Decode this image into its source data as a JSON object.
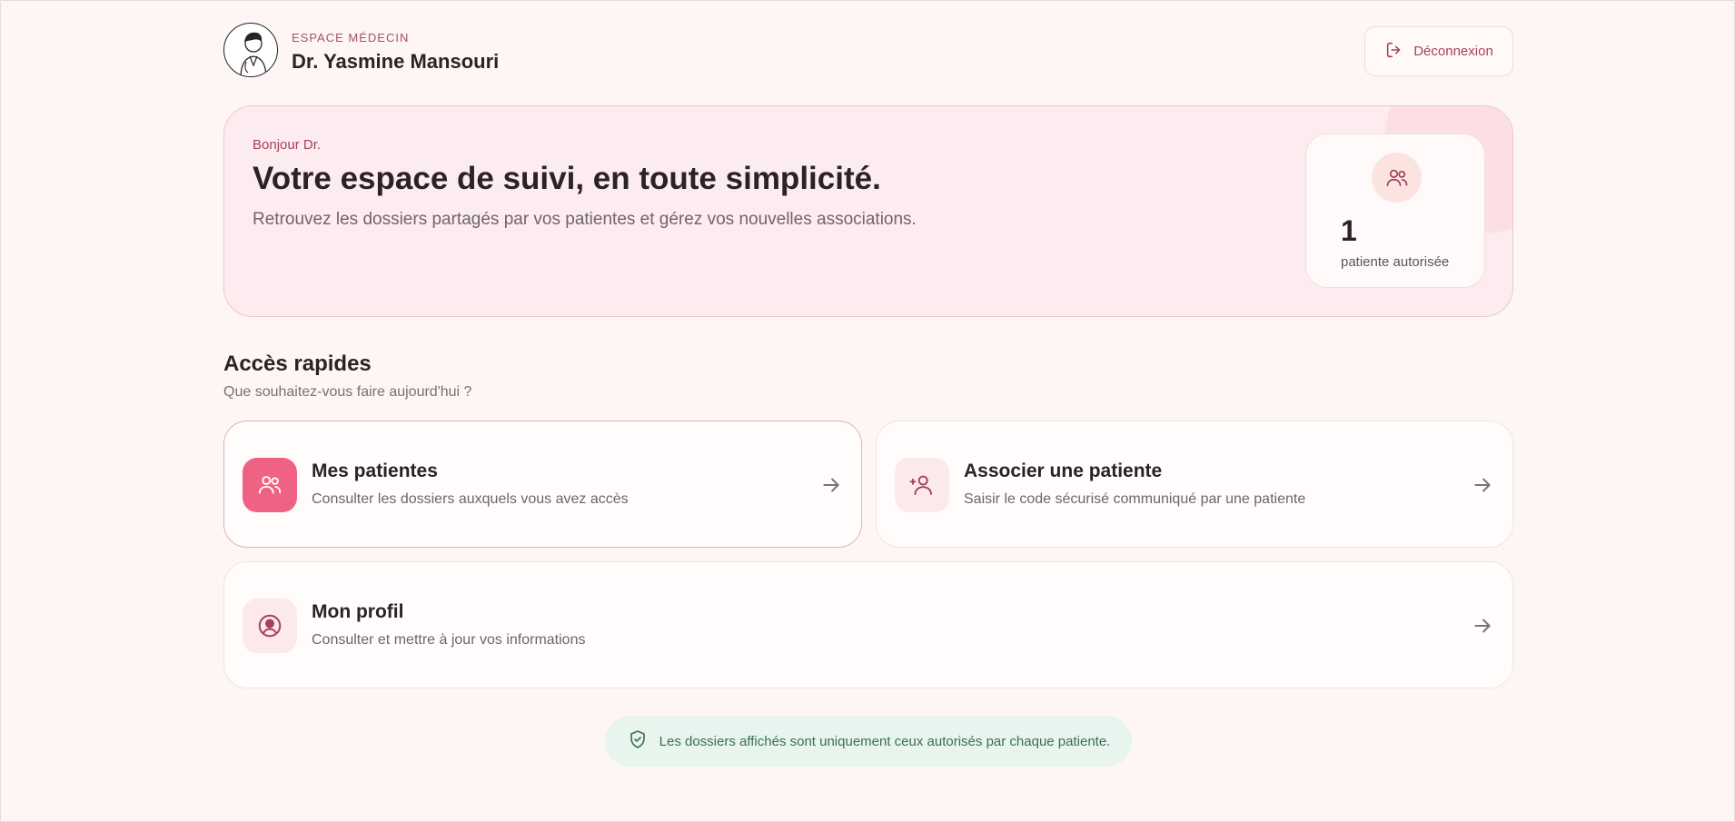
{
  "header": {
    "eyebrow": "ESPACE MÉDECIN",
    "doctor_name": "Dr. Yasmine Mansouri",
    "logout_label": "Déconnexion",
    "avatar_icon": "doctor-avatar-icon",
    "logout_icon": "logout-icon"
  },
  "hero": {
    "greeting": "Bonjour Dr.",
    "title": "Votre espace de suivi, en toute simplicité.",
    "subtitle": "Retrouvez les dossiers partagés par vos patientes et gérez vos nouvelles associations.",
    "stat": {
      "icon": "users-icon",
      "value": "1",
      "label": "patiente autorisée"
    }
  },
  "quick_access": {
    "title": "Accès rapides",
    "subtitle": "Que souhaitez-vous faire aujourd'hui ?",
    "cards": [
      {
        "icon": "users-icon",
        "title": "Mes patientes",
        "description": "Consulter les dossiers auxquels vous avez accès"
      },
      {
        "icon": "user-plus-icon",
        "title": "Associer une patiente",
        "description": "Saisir le code sécurisé communiqué par une patiente"
      },
      {
        "icon": "user-circle-icon",
        "title": "Mon profil",
        "description": "Consulter et mettre à jour vos informations"
      }
    ]
  },
  "notice": {
    "icon": "shield-check-icon",
    "text": "Les dossiers affichés sont uniquement ceux autorisés par chaque patiente."
  },
  "colors": {
    "accent": "#a5405f",
    "primary_pink": "#ef6283",
    "background": "#fef6f4",
    "notice_green": "#3b6e57"
  }
}
